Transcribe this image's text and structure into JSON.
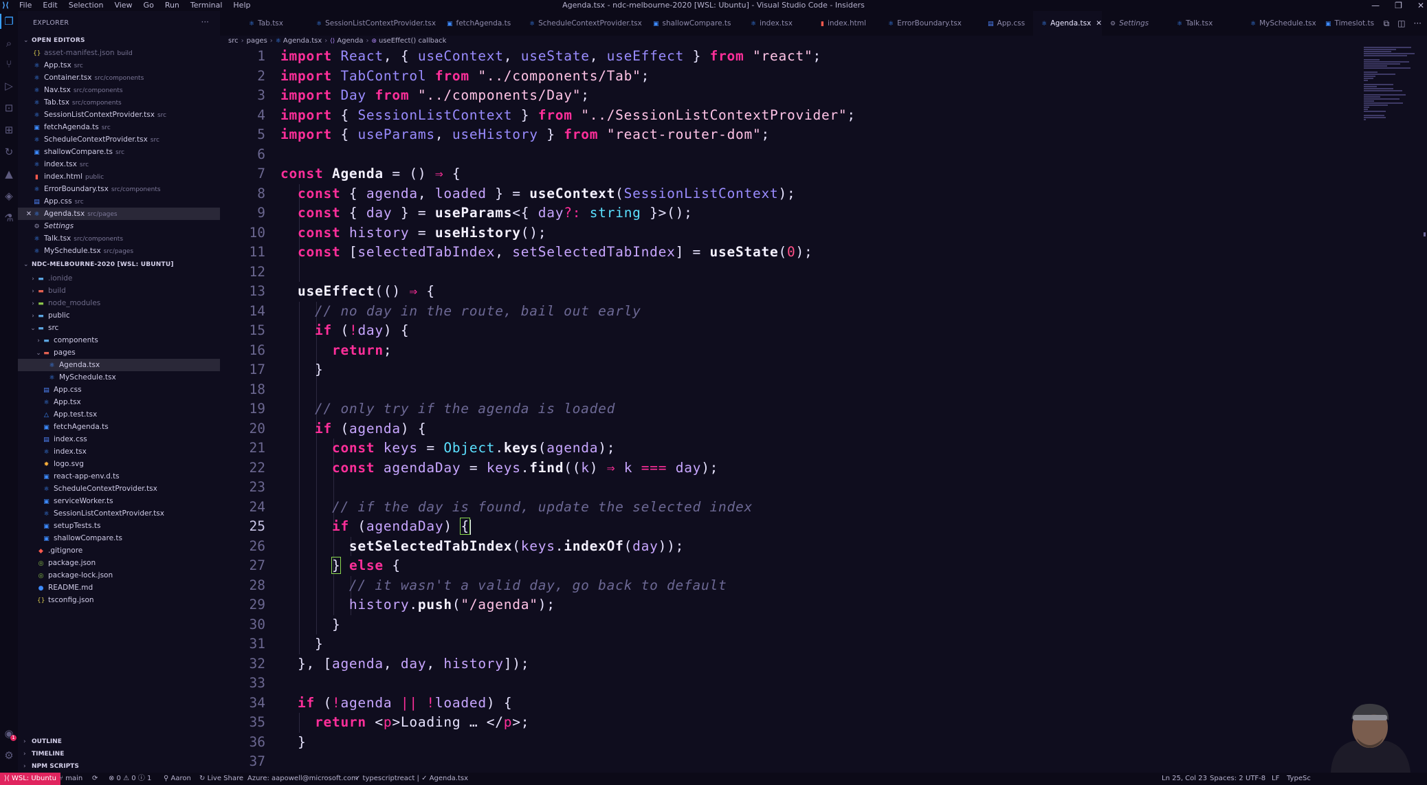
{
  "window": {
    "title": "Agenda.tsx - ndc-melbourne-2020 [WSL: Ubuntu] - Visual Studio Code - Insiders",
    "menus": [
      "File",
      "Edit",
      "Selection",
      "View",
      "Go",
      "Run",
      "Terminal",
      "Help"
    ],
    "controls": [
      "—",
      "❐",
      "✕"
    ]
  },
  "sidebar": {
    "header": "EXPLORER",
    "open_editors_title": "OPEN EDITORS",
    "open_editors": [
      {
        "name": "asset-manifest.json",
        "desc": "build",
        "icon": "json-icon",
        "dim": true
      },
      {
        "name": "App.tsx",
        "desc": "src",
        "icon": "tsx-icon"
      },
      {
        "name": "Container.tsx",
        "desc": "src/components",
        "icon": "tsx-icon"
      },
      {
        "name": "Nav.tsx",
        "desc": "src/components",
        "icon": "tsx-icon"
      },
      {
        "name": "Tab.tsx",
        "desc": "src/components",
        "icon": "tsx-icon"
      },
      {
        "name": "SessionListContextProvider.tsx",
        "desc": "src",
        "icon": "tsx-icon"
      },
      {
        "name": "fetchAgenda.ts",
        "desc": "src",
        "icon": "ts-icon"
      },
      {
        "name": "ScheduleContextProvider.tsx",
        "desc": "src",
        "icon": "tsx-icon"
      },
      {
        "name": "shallowCompare.ts",
        "desc": "src",
        "icon": "ts-icon"
      },
      {
        "name": "index.tsx",
        "desc": "src",
        "icon": "tsx-icon"
      },
      {
        "name": "index.html",
        "desc": "public",
        "icon": "html-icon"
      },
      {
        "name": "ErrorBoundary.tsx",
        "desc": "src/components",
        "icon": "tsx-icon"
      },
      {
        "name": "App.css",
        "desc": "src",
        "icon": "css-icon"
      },
      {
        "name": "Agenda.tsx",
        "desc": "src/pages",
        "icon": "tsx-icon",
        "active": true
      },
      {
        "name": "Settings",
        "desc": "",
        "icon": "settings-icon",
        "italic": true
      },
      {
        "name": "Talk.tsx",
        "desc": "src/components",
        "icon": "tsx-icon"
      },
      {
        "name": "MySchedule.tsx",
        "desc": "src/pages",
        "icon": "tsx-icon"
      }
    ],
    "workspace_title": "NDC-MELBOURNE-2020 [WSL: UBUNTU]",
    "tree": [
      {
        "name": ".ionide",
        "depth": 1,
        "kind": "folder",
        "dim": true
      },
      {
        "name": "build",
        "depth": 1,
        "kind": "folder-red",
        "dim": true
      },
      {
        "name": "node_modules",
        "depth": 1,
        "kind": "folder-grn",
        "dim": true
      },
      {
        "name": "public",
        "depth": 1,
        "kind": "folder"
      },
      {
        "name": "src",
        "depth": 1,
        "kind": "folder-open"
      },
      {
        "name": "components",
        "depth": 2,
        "kind": "folder"
      },
      {
        "name": "pages",
        "depth": 2,
        "kind": "folder-open-red"
      },
      {
        "name": "Agenda.tsx",
        "depth": 3,
        "kind": "tsx",
        "active": true
      },
      {
        "name": "MySchedule.tsx",
        "depth": 3,
        "kind": "tsx"
      },
      {
        "name": "App.css",
        "depth": 2,
        "kind": "css"
      },
      {
        "name": "App.tsx",
        "depth": 2,
        "kind": "tsx"
      },
      {
        "name": "App.test.tsx",
        "depth": 2,
        "kind": "test"
      },
      {
        "name": "fetchAgenda.ts",
        "depth": 2,
        "kind": "ts"
      },
      {
        "name": "index.css",
        "depth": 2,
        "kind": "css"
      },
      {
        "name": "index.tsx",
        "depth": 2,
        "kind": "tsx"
      },
      {
        "name": "logo.svg",
        "depth": 2,
        "kind": "svg"
      },
      {
        "name": "react-app-env.d.ts",
        "depth": 2,
        "kind": "ts"
      },
      {
        "name": "ScheduleContextProvider.tsx",
        "depth": 2,
        "kind": "tsx"
      },
      {
        "name": "serviceWorker.ts",
        "depth": 2,
        "kind": "ts"
      },
      {
        "name": "SessionListContextProvider.tsx",
        "depth": 2,
        "kind": "tsx"
      },
      {
        "name": "setupTests.ts",
        "depth": 2,
        "kind": "ts"
      },
      {
        "name": "shallowCompare.ts",
        "depth": 2,
        "kind": "ts"
      },
      {
        "name": ".gitignore",
        "depth": 1,
        "kind": "git"
      },
      {
        "name": "package.json",
        "depth": 1,
        "kind": "json-pkg"
      },
      {
        "name": "package-lock.json",
        "depth": 1,
        "kind": "json-pkg"
      },
      {
        "name": "README.md",
        "depth": 1,
        "kind": "info"
      },
      {
        "name": "tsconfig.json",
        "depth": 1,
        "kind": "json"
      }
    ],
    "bottom_sections": [
      "OUTLINE",
      "TIMELINE",
      "NPM SCRIPTS"
    ]
  },
  "tabs": [
    {
      "label": "Tab.tsx",
      "icon": "tsx-icon"
    },
    {
      "label": "SessionListContextProvider.tsx",
      "icon": "tsx-icon"
    },
    {
      "label": "fetchAgenda.ts",
      "icon": "ts-icon"
    },
    {
      "label": "ScheduleContextProvider.tsx",
      "icon": "tsx-icon"
    },
    {
      "label": "shallowCompare.ts",
      "icon": "ts-icon"
    },
    {
      "label": "index.tsx",
      "icon": "tsx-icon"
    },
    {
      "label": "index.html",
      "icon": "html-icon"
    },
    {
      "label": "ErrorBoundary.tsx",
      "icon": "tsx-icon"
    },
    {
      "label": "App.css",
      "icon": "css-icon"
    },
    {
      "label": "Agenda.tsx",
      "icon": "tsx-icon",
      "active": true
    },
    {
      "label": "Settings",
      "icon": "settings-icon",
      "italic": true
    },
    {
      "label": "Talk.tsx",
      "icon": "tsx-icon"
    },
    {
      "label": "MySchedule.tsx",
      "icon": "tsx-icon"
    },
    {
      "label": "Timeslot.ts",
      "icon": "ts-icon"
    }
  ],
  "breadcrumb": [
    "src",
    "pages",
    "Agenda.tsx",
    "Agenda",
    "useEffect() callback"
  ],
  "editor": {
    "current_line": 25,
    "lines": [
      [
        [
          "kw",
          "import"
        ],
        [
          "p",
          " "
        ],
        [
          "id",
          "React"
        ],
        [
          "p",
          ", { "
        ],
        [
          "id",
          "useContext"
        ],
        [
          "p",
          ", "
        ],
        [
          "id",
          "useState"
        ],
        [
          "p",
          ", "
        ],
        [
          "id",
          "useEffect"
        ],
        [
          "p",
          " } "
        ],
        [
          "kw",
          "from"
        ],
        [
          "p",
          " "
        ],
        [
          "str",
          "\"react\""
        ],
        [
          "p",
          ";"
        ]
      ],
      [
        [
          "kw",
          "import"
        ],
        [
          "p",
          " "
        ],
        [
          "id",
          "TabControl"
        ],
        [
          "p",
          " "
        ],
        [
          "kw",
          "from"
        ],
        [
          "p",
          " "
        ],
        [
          "str",
          "\"../components/Tab\""
        ],
        [
          "p",
          ";"
        ]
      ],
      [
        [
          "kw",
          "import"
        ],
        [
          "p",
          " "
        ],
        [
          "id",
          "Day"
        ],
        [
          "p",
          " "
        ],
        [
          "kw",
          "from"
        ],
        [
          "p",
          " "
        ],
        [
          "str",
          "\"../components/Day\""
        ],
        [
          "p",
          ";"
        ]
      ],
      [
        [
          "kw",
          "import"
        ],
        [
          "p",
          " { "
        ],
        [
          "id",
          "SessionListContext"
        ],
        [
          "p",
          " } "
        ],
        [
          "kw",
          "from"
        ],
        [
          "p",
          " "
        ],
        [
          "str",
          "\"../SessionListContextProvider\""
        ],
        [
          "p",
          ";"
        ]
      ],
      [
        [
          "kw",
          "import"
        ],
        [
          "p",
          " { "
        ],
        [
          "id",
          "useParams"
        ],
        [
          "p",
          ", "
        ],
        [
          "id",
          "useHistory"
        ],
        [
          "p",
          " } "
        ],
        [
          "kw",
          "from"
        ],
        [
          "p",
          " "
        ],
        [
          "str",
          "\"react-router-dom\""
        ],
        [
          "p",
          ";"
        ]
      ],
      [],
      [
        [
          "kw",
          "const"
        ],
        [
          "p",
          " "
        ],
        [
          "fn",
          "Agenda"
        ],
        [
          "p",
          " = () "
        ],
        [
          "op",
          "⇒"
        ],
        [
          "p",
          " {"
        ]
      ],
      [
        [
          "p",
          "  "
        ],
        [
          "kw",
          "const"
        ],
        [
          "p",
          " { "
        ],
        [
          "var",
          "agenda"
        ],
        [
          "p",
          ", "
        ],
        [
          "var",
          "loaded"
        ],
        [
          "p",
          " } = "
        ],
        [
          "fn",
          "useContext"
        ],
        [
          "p",
          "("
        ],
        [
          "id",
          "SessionListContext"
        ],
        [
          "p",
          ");"
        ]
      ],
      [
        [
          "p",
          "  "
        ],
        [
          "kw",
          "const"
        ],
        [
          "p",
          " { "
        ],
        [
          "var",
          "day"
        ],
        [
          "p",
          " } = "
        ],
        [
          "fn",
          "useParams"
        ],
        [
          "p",
          "<{ "
        ],
        [
          "var",
          "day"
        ],
        [
          "op",
          "?:"
        ],
        [
          "p",
          " "
        ],
        [
          "type",
          "string"
        ],
        [
          "p",
          " }>();"
        ]
      ],
      [
        [
          "p",
          "  "
        ],
        [
          "kw",
          "const"
        ],
        [
          "p",
          " "
        ],
        [
          "var",
          "history"
        ],
        [
          "p",
          " = "
        ],
        [
          "fn",
          "useHistory"
        ],
        [
          "p",
          "();"
        ]
      ],
      [
        [
          "p",
          "  "
        ],
        [
          "kw",
          "const"
        ],
        [
          "p",
          " ["
        ],
        [
          "var",
          "selectedTabIndex"
        ],
        [
          "p",
          ", "
        ],
        [
          "var",
          "setSelectedTabIndex"
        ],
        [
          "p",
          "] = "
        ],
        [
          "fn",
          "useState"
        ],
        [
          "p",
          "("
        ],
        [
          "num",
          "0"
        ],
        [
          "p",
          ");"
        ]
      ],
      [],
      [
        [
          "p",
          "  "
        ],
        [
          "fn",
          "useEffect"
        ],
        [
          "p",
          "(() "
        ],
        [
          "op",
          "⇒"
        ],
        [
          "p",
          " {"
        ]
      ],
      [
        [
          "p",
          "    "
        ],
        [
          "cm",
          "// no day in the route, bail out early"
        ]
      ],
      [
        [
          "p",
          "    "
        ],
        [
          "ctl",
          "if"
        ],
        [
          "p",
          " ("
        ],
        [
          "op",
          "!"
        ],
        [
          "var",
          "day"
        ],
        [
          "p",
          ") {"
        ]
      ],
      [
        [
          "p",
          "      "
        ],
        [
          "ctl",
          "return"
        ],
        [
          "p",
          ";"
        ]
      ],
      [
        [
          "p",
          "    }"
        ]
      ],
      [],
      [
        [
          "p",
          "    "
        ],
        [
          "cm",
          "// only try if the agenda is loaded"
        ]
      ],
      [
        [
          "p",
          "    "
        ],
        [
          "ctl",
          "if"
        ],
        [
          "p",
          " ("
        ],
        [
          "var",
          "agenda"
        ],
        [
          "p",
          ") {"
        ]
      ],
      [
        [
          "p",
          "      "
        ],
        [
          "kw",
          "const"
        ],
        [
          "p",
          " "
        ],
        [
          "var",
          "keys"
        ],
        [
          "p",
          " = "
        ],
        [
          "obj",
          "Object"
        ],
        [
          "p",
          "."
        ],
        [
          "fn",
          "keys"
        ],
        [
          "p",
          "("
        ],
        [
          "var",
          "agenda"
        ],
        [
          "p",
          ");"
        ]
      ],
      [
        [
          "p",
          "      "
        ],
        [
          "kw",
          "const"
        ],
        [
          "p",
          " "
        ],
        [
          "var",
          "agendaDay"
        ],
        [
          "p",
          " = "
        ],
        [
          "var",
          "keys"
        ],
        [
          "p",
          "."
        ],
        [
          "fn",
          "find"
        ],
        [
          "p",
          "(("
        ],
        [
          "var",
          "k"
        ],
        [
          "p",
          ") "
        ],
        [
          "op",
          "⇒"
        ],
        [
          "p",
          " "
        ],
        [
          "var",
          "k"
        ],
        [
          "p",
          " "
        ],
        [
          "op",
          "==="
        ],
        [
          "p",
          " "
        ],
        [
          "var",
          "day"
        ],
        [
          "p",
          ");"
        ]
      ],
      [],
      [
        [
          "p",
          "      "
        ],
        [
          "cm",
          "// if the day is found, update the selected index"
        ]
      ],
      [
        [
          "p",
          "      "
        ],
        [
          "ctl",
          "if"
        ],
        [
          "p",
          " ("
        ],
        [
          "var",
          "agendaDay"
        ],
        [
          "p",
          ") "
        ],
        [
          "brace",
          "{"
        ]
      ],
      [
        [
          "p",
          "        "
        ],
        [
          "fn",
          "setSelectedTabIndex"
        ],
        [
          "p",
          "("
        ],
        [
          "var",
          "keys"
        ],
        [
          "p",
          "."
        ],
        [
          "fn",
          "indexOf"
        ],
        [
          "p",
          "("
        ],
        [
          "var",
          "day"
        ],
        [
          "p",
          "));"
        ]
      ],
      [
        [
          "p",
          "      "
        ],
        [
          "brace",
          "}"
        ],
        [
          "p",
          " "
        ],
        [
          "ctl",
          "else"
        ],
        [
          "p",
          " {"
        ]
      ],
      [
        [
          "p",
          "        "
        ],
        [
          "cm",
          "// it wasn't a valid day, go back to default"
        ]
      ],
      [
        [
          "p",
          "        "
        ],
        [
          "var",
          "history"
        ],
        [
          "p",
          "."
        ],
        [
          "fn",
          "push"
        ],
        [
          "p",
          "("
        ],
        [
          "str",
          "\"/agenda\""
        ],
        [
          "p",
          ");"
        ]
      ],
      [
        [
          "p",
          "      }"
        ]
      ],
      [
        [
          "p",
          "    }"
        ]
      ],
      [
        [
          "p",
          "  }, ["
        ],
        [
          "var",
          "agenda"
        ],
        [
          "p",
          ", "
        ],
        [
          "var",
          "day"
        ],
        [
          "p",
          ", "
        ],
        [
          "var",
          "history"
        ],
        [
          "p",
          "]);"
        ]
      ],
      [],
      [
        [
          "p",
          "  "
        ],
        [
          "ctl",
          "if"
        ],
        [
          "p",
          " ("
        ],
        [
          "op",
          "!"
        ],
        [
          "var",
          "agenda"
        ],
        [
          "p",
          " "
        ],
        [
          "op",
          "||"
        ],
        [
          "p",
          " "
        ],
        [
          "op",
          "!"
        ],
        [
          "var",
          "loaded"
        ],
        [
          "p",
          ") {"
        ]
      ],
      [
        [
          "p",
          "    "
        ],
        [
          "ctl",
          "return"
        ],
        [
          "p",
          " <"
        ],
        [
          "tag",
          "p"
        ],
        [
          "p",
          ">Loading … </"
        ],
        [
          "tag",
          "p"
        ],
        [
          "p",
          ">;"
        ]
      ],
      [
        [
          "p",
          "  }"
        ]
      ],
      []
    ]
  },
  "statusbar": {
    "remote": "WSL: Ubuntu",
    "branch": "main",
    "sync": "⟳",
    "problems": "⊗ 0 ⚠ 0 ⓘ 1",
    "user": "Aaron",
    "liveshare": "Live Share",
    "azure": "Azure: aapowell@microsoft.com",
    "lint": "✓ typescriptreact | ✓ Agenda.tsx",
    "position": "Ln 25, Col 23",
    "spaces": "Spaces: 2",
    "encoding": "UTF-8",
    "eol": "LF",
    "language": "TypeSc"
  },
  "colors": {
    "background": "#0f0d1e",
    "accent": "#e0245e",
    "keyword": "#ff2f9a",
    "identifier": "#9a8cff",
    "string": "#ffc3e6",
    "type": "#5be0ff"
  }
}
